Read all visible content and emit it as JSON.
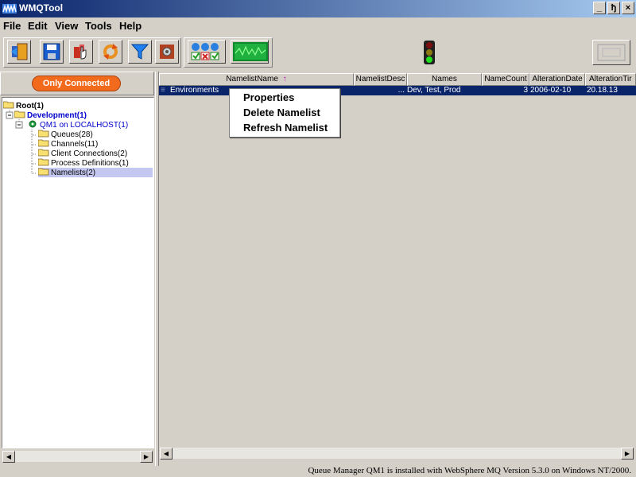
{
  "window": {
    "title": "WMQTool",
    "minimize": "_",
    "restore": "ђ",
    "close": "×"
  },
  "menu": [
    {
      "label": "File"
    },
    {
      "label": "Edit"
    },
    {
      "label": "View"
    },
    {
      "label": "Tools"
    },
    {
      "label": "Help"
    }
  ],
  "toolbar": {
    "icons": [
      "exit-icon",
      "save-icon",
      "hand-icon",
      "refresh-icon",
      "filter-icon",
      "settings-icon",
      "queue-status-icon",
      "monitor-icon",
      "traffic-light-icon",
      "blank-panel-icon"
    ]
  },
  "filter": {
    "label": "Only Connected",
    "color": "#f26a1c"
  },
  "tree": {
    "root": "Root(1)",
    "development": "Development(1)",
    "qmgr": "QM1 on LOCALHOST(1)",
    "items": [
      {
        "label": "Queues(28)"
      },
      {
        "label": "Channels(11)"
      },
      {
        "label": "Client Connections(2)"
      },
      {
        "label": "Process Definitions(1)"
      },
      {
        "label": "Namelists(2)"
      }
    ],
    "selected_index": 4
  },
  "table": {
    "columns": [
      "NamelistName",
      "NamelistDesc",
      "Names",
      "NameCount",
      "AlterationDate",
      "AlterationTir"
    ],
    "sort_indicator": "↑",
    "rows": [
      {
        "name": "Environments",
        "desc": "...",
        "names": "Dev, Test, Prod",
        "count": "3",
        "date": "2006-02-10",
        "time": "20.18.13"
      }
    ]
  },
  "context_menu": [
    {
      "label": "Properties"
    },
    {
      "label": "Delete Namelist"
    },
    {
      "label": "Refresh Namelist"
    }
  ],
  "status": "Queue Manager QM1 is installed with WebSphere MQ Version 5.3.0 on Windows NT/2000.",
  "colors": {
    "titlebar": "#0a246a",
    "selection": "#0a246a",
    "tree_selected": "#c4c8f0",
    "tree_blue": "#0000cc"
  }
}
